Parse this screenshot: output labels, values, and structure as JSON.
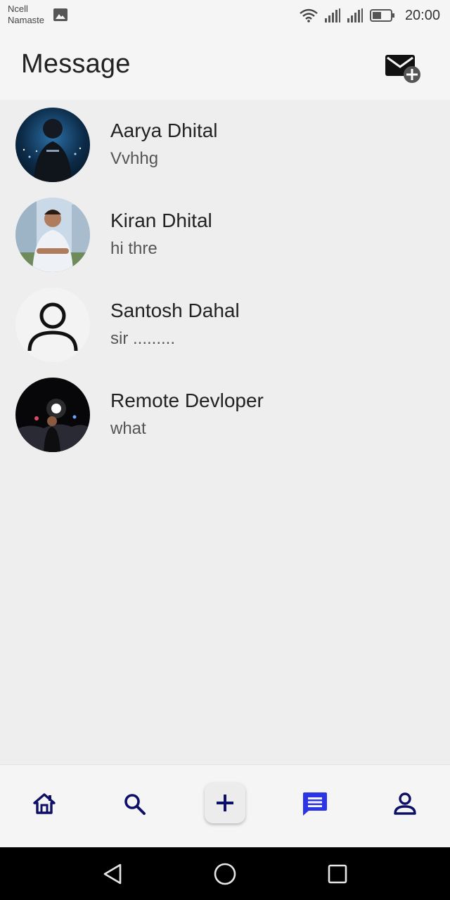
{
  "status_bar": {
    "carrier_line1": "Ncell",
    "carrier_line2": "Namaste",
    "time": "20:00",
    "icons": [
      "gallery-icon",
      "wifi-icon",
      "signal-icon",
      "signal-icon",
      "battery-icon"
    ]
  },
  "header": {
    "title": "Message",
    "compose_icon": "compose-mail-icon"
  },
  "conversations": [
    {
      "name": "Aarya Dhital",
      "preview": "Vvhhg",
      "avatar": "photo"
    },
    {
      "name": "Kiran Dhital",
      "preview": "hi thre",
      "avatar": "photo"
    },
    {
      "name": "Santosh Dahal",
      "preview": "sir .........",
      "avatar": "default-person-icon"
    },
    {
      "name": "Remote Devloper",
      "preview": "what",
      "avatar": "photo"
    }
  ],
  "bottom_nav": {
    "items": [
      "home-icon",
      "search-icon",
      "add-icon",
      "messages-icon",
      "profile-icon"
    ],
    "active": "messages-icon"
  },
  "system_nav": {
    "items": [
      "back-icon",
      "home-circle-icon",
      "recents-icon"
    ]
  },
  "colors": {
    "nav_icon": "#0d1066",
    "nav_active": "#2b35e6",
    "background": "#eeeeee",
    "bar": "#f5f5f5"
  }
}
